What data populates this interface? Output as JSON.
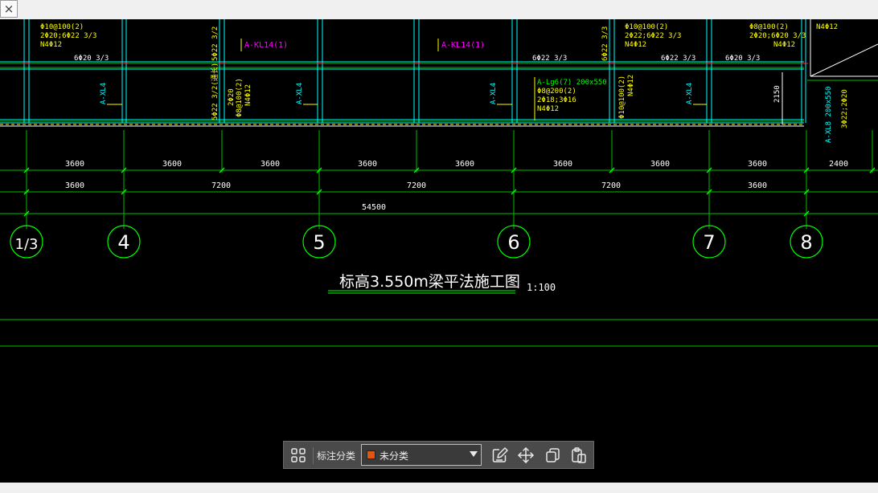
{
  "window": {
    "close_glyph": "×"
  },
  "drawing": {
    "title": "标高3.550m梁平法施工图",
    "scale": "1:100",
    "colors": {
      "grid": "#00ff00",
      "beam_label": "#ff00ff",
      "rebar_text": "#ffff00",
      "secondary_beam": "#00ffff",
      "dimension": "#ffffff"
    },
    "axes": [
      "1/3",
      "4",
      "5",
      "6",
      "7",
      "8"
    ],
    "dims_row1": [
      "3600",
      "3600",
      "3600",
      "3600",
      "3600",
      "3600",
      "3600",
      "3600",
      "2400"
    ],
    "dims_row2": [
      "3600",
      "7200",
      "7200",
      "7200",
      "3600"
    ],
    "dim_total": "54500",
    "beam_labels": [
      "A-KL14(1)",
      "A-KL14(1)"
    ],
    "xl_labels": [
      "A-XL4",
      "A-XL4",
      "A-XL4",
      "A-XL4"
    ],
    "lg_label": "A-Lg6(7) 200x550",
    "right_vert_label": "A-XL8 200x550",
    "dim_2150": "2150",
    "rebar_top": [
      {
        "l1": "Φ10@100(2)",
        "l2": "2Φ20;6Φ22 3/3",
        "l3": "N4Φ12"
      },
      {
        "l1": "Φ10@100(2)",
        "l2": "2Φ22;6Φ22 3/3",
        "l3": "N4Φ12"
      },
      {
        "l1": "Φ8@100(2)",
        "l2": "2Φ20;6Φ20 3/3",
        "l3": "N4Φ12"
      }
    ],
    "bottom_rebar": [
      "6Φ20 3/3",
      "6Φ22 3/3",
      "6Φ22 3/3",
      "6Φ20 3/3"
    ],
    "right_top_text": "N4Φ12",
    "vert_texts": [
      "5Φ22 3/2",
      "5Φ22 3/2(通长)",
      "2Φ20",
      "Φ8@100(2)",
      "N4Φ12",
      "6Φ22 3/3",
      "N4Φ12",
      "Φ10@100(2)",
      "3Φ22;2Φ20"
    ],
    "lg_text": [
      "Φ8@200(2)",
      "2Φ18;3Φ16",
      "N4Φ12"
    ]
  },
  "toolbar": {
    "category_label": "标注分类",
    "selected_option": "未分类",
    "swatch_color": "#e0570f",
    "icons": [
      "grid-icon",
      "edit-icon",
      "move-icon",
      "copy-icon",
      "paste-icon"
    ]
  }
}
